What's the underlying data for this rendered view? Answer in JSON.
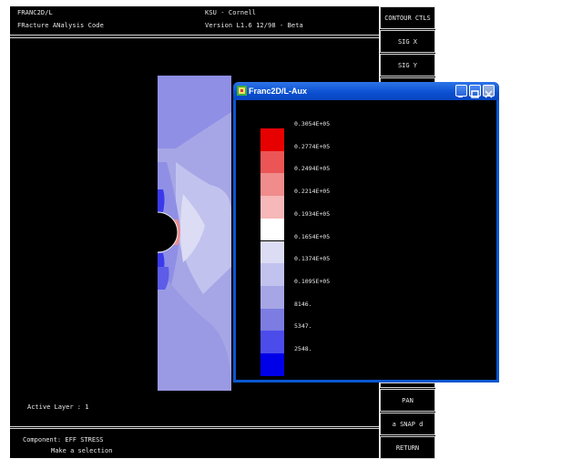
{
  "header": {
    "app_name": "FRANC2D/L",
    "app_desc": "FRacture ANalysis Code",
    "org": "KSU - Cornell",
    "version": "Version L1.6 12/98 - Beta"
  },
  "menu": {
    "top_buttons": [
      "CONTOUR CTLS",
      "SIG X",
      "SIG Y"
    ],
    "bottom_buttons": [
      "PAN",
      "a SNAP d",
      "RETURN"
    ]
  },
  "aux_window": {
    "title": "Franc2D/L-Aux",
    "legend": {
      "values": [
        "0.3054E+05",
        "0.2774E+05",
        "0.2494E+05",
        "0.2214E+05",
        "0.1934E+05",
        "0.1654E+05",
        "0.1374E+05",
        "0.1095E+05",
        "8146.",
        "5347.",
        "2548."
      ],
      "colors": [
        "#e60000",
        "#ec5555",
        "#f08c8c",
        "#f6b8b8",
        "#ffffff",
        "#dcdcf4",
        "#c2c2ee",
        "#a6a6e6",
        "#7c7ce2",
        "#4c4cea",
        "#0000e8"
      ]
    }
  },
  "status": {
    "active_layer": "Active Layer :  1",
    "component": "Component: EFF STRESS",
    "prompt": "Make a selection"
  }
}
